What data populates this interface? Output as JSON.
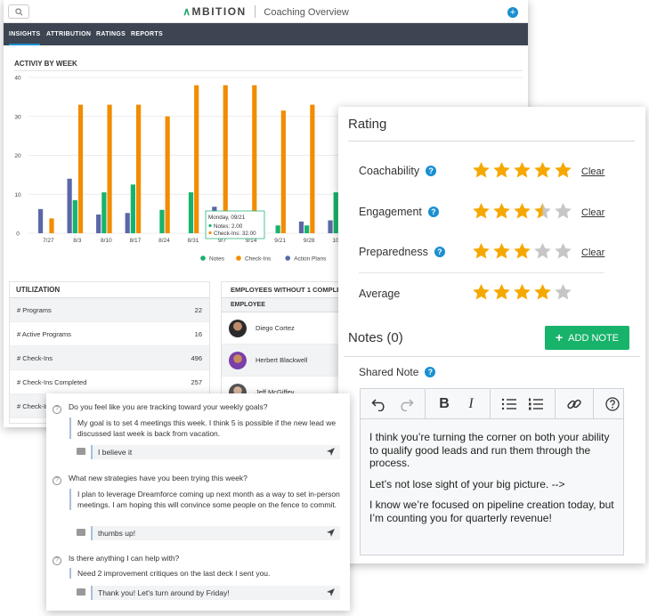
{
  "header": {
    "logo_mark": "∧",
    "logo_text": "MBITION",
    "subtitle": "Coaching Overview",
    "add_symbol": "+"
  },
  "nav": {
    "tabs": [
      {
        "label": "INSIGHTS"
      },
      {
        "label": "ATTRIBUTION"
      },
      {
        "label": "RATINGS"
      },
      {
        "label": "REPORTS"
      }
    ]
  },
  "activity": {
    "title": "ACTIVIY BY WEEK"
  },
  "chart_data": {
    "type": "bar",
    "categories": [
      "7/27",
      "8/3",
      "8/10",
      "8/17",
      "8/24",
      "8/31",
      "9/7",
      "9/14",
      "9/21",
      "9/28",
      "10/5"
    ],
    "series": [
      {
        "name": "Notes",
        "color": "#17b36a",
        "values": [
          0,
          8.5,
          10.5,
          12.5,
          6,
          10.5,
          0,
          5.5,
          2,
          2,
          10.5
        ]
      },
      {
        "name": "Check-Ins",
        "color": "#f28c00",
        "values": [
          3.8,
          33,
          33,
          33,
          30,
          38,
          38,
          38,
          31.5,
          33,
          30
        ]
      },
      {
        "name": "Action Plans",
        "color": "#5a68a8",
        "values": [
          6.2,
          14,
          4.8,
          5.2,
          0,
          0,
          6.8,
          0,
          0,
          3,
          3.3
        ]
      }
    ],
    "ylim": [
      0,
      40
    ],
    "yticks": [
      0,
      10,
      20,
      30,
      40
    ],
    "legend_position": "bottom",
    "tooltip": {
      "date": "Monday, 09/21",
      "lines": [
        "Notes: 2.00",
        "Check-Ins: 32.00"
      ]
    }
  },
  "utilization": {
    "title": "UTILIZATION",
    "rows": [
      {
        "label": "# Programs",
        "value": "22"
      },
      {
        "label": "# Active Programs",
        "value": "16"
      },
      {
        "label": "# Check-Ins",
        "value": "496"
      },
      {
        "label": "# Check-Ins Completed",
        "value": "257"
      },
      {
        "label": "# Check-Ins",
        "value": ""
      }
    ]
  },
  "employees": {
    "title": "EMPLOYEES WITHOUT 1 COMPLETED",
    "column": "EMPLOYEE",
    "rows": [
      {
        "name": "Diego Cortez"
      },
      {
        "name": "Herbert Blackwell"
      },
      {
        "name": "Jeff McGiffey"
      }
    ]
  },
  "rating": {
    "title": "Rating",
    "items": [
      {
        "label": "Coachability",
        "rating": 5,
        "clear": "Clear"
      },
      {
        "label": "Engagement",
        "rating": 3.5,
        "clear": "Clear"
      },
      {
        "label": "Preparedness",
        "rating": 3,
        "clear": "Clear"
      }
    ],
    "average": {
      "label": "Average",
      "rating": 4
    },
    "help_symbol": "?",
    "star_color": "#f5a800",
    "star_empty_color": "#c6c6c6"
  },
  "notes": {
    "title": "Notes (0)",
    "add_label": "ADD NOTE",
    "add_symbol": "+",
    "shared_label": "Shared Note",
    "toolbar": {
      "bold": "B",
      "italic": "I"
    },
    "paragraphs": [
      "I think you’re turning the corner on both your ability to qualify good leads and run them through the process.",
      "Let’s not lose sight of your big picture. -->",
      "I know we’re focused on pipeline creation today, but I’m counting you for quarterly revenue!"
    ]
  },
  "questions": {
    "symbol": "?",
    "items": [
      {
        "q": "Do you feel like you are tracking toward your weekly goals?",
        "a": "My goal is to set 4 meetings this week. I think 5 is possible if the new lead we discussed last week is back from vacation.",
        "reply": "I believe it"
      },
      {
        "q": "What new strategies have you been trying this week?",
        "a": "I plan to leverage Dreamforce coming up next month as a way to set in-person meetings. I am hoping this will convince some people on the fence to commit.",
        "reply": "thumbs up!"
      },
      {
        "q": "Is there anything I can help with?",
        "a": "Need 2 improvement critiques on the last deck I sent you.",
        "reply": "Thank you! Let's turn around by Friday!"
      }
    ]
  }
}
